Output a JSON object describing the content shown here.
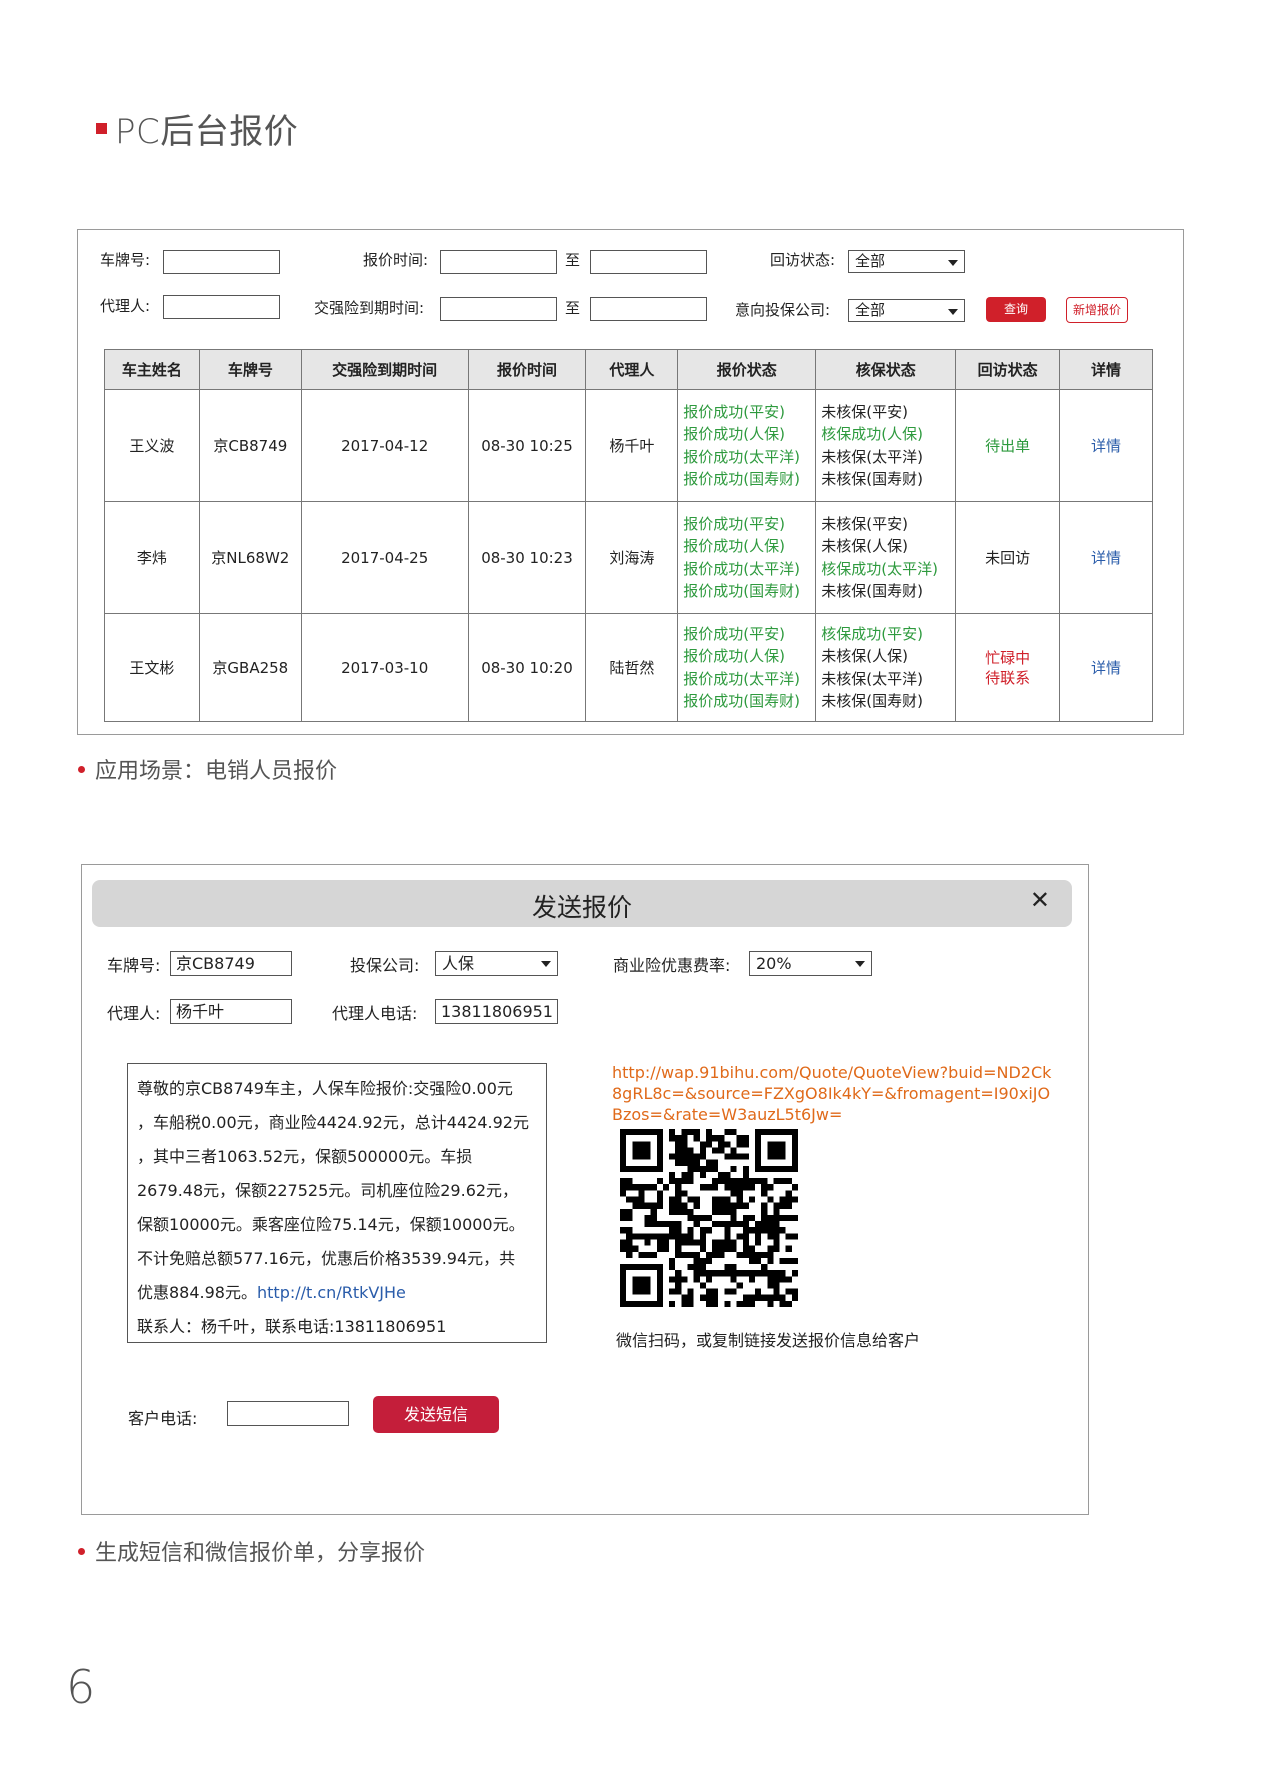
{
  "page_title": "PC后台报价",
  "caption1": "应用场景：电销人员报价",
  "caption2": "生成短信和微信报价单，分享报价",
  "page_number": "6",
  "search": {
    "plate_label": "车牌号:",
    "quote_time_label": "报价时间:",
    "to1": "至",
    "visit_status_label": "回访状态:",
    "visit_status_value": "全部",
    "agent_label": "代理人:",
    "expiry_label": "交强险到期时间:",
    "to2": "至",
    "company_label": "意向投保公司:",
    "company_value": "全部",
    "query_button": "查询",
    "new_quote_button": "新增报价"
  },
  "table": {
    "headers": [
      "车主姓名",
      "车牌号",
      "交强险到期时间",
      "报价时间",
      "代理人",
      "报价状态",
      "核保状态",
      "回访状态",
      "详情"
    ],
    "rows": [
      {
        "owner": "王义波",
        "plate": "京CB8749",
        "expiry": "2017-04-12",
        "quote_time": "08-30 10:25",
        "agent": "杨千叶",
        "quote_status": [
          "报价成功(平安)",
          "报价成功(人保)",
          "报价成功(太平洋)",
          "报价成功(国寿财)"
        ],
        "uw_status": [
          "未核保(平安)",
          "核保成功(人保)",
          "未核保(太平洋)",
          "未核保(国寿财)"
        ],
        "visit_line1": "待出单",
        "visit_line2": "",
        "detail": "详情"
      },
      {
        "owner": "李炜",
        "plate": "京NL68W2",
        "expiry": "2017-04-25",
        "quote_time": "08-30 10:23",
        "agent": "刘海涛",
        "quote_status": [
          "报价成功(平安)",
          "报价成功(人保)",
          "报价成功(太平洋)",
          "报价成功(国寿财)"
        ],
        "uw_status": [
          "未核保(平安)",
          "未核保(人保)",
          "核保成功(太平洋)",
          "未核保(国寿财)"
        ],
        "visit_line1": "未回访",
        "visit_line2": "",
        "detail": "详情"
      },
      {
        "owner": "王文彬",
        "plate": "京GBA258",
        "expiry": "2017-03-10",
        "quote_time": "08-30 10:20",
        "agent": "陆哲然",
        "quote_status": [
          "报价成功(平安)",
          "报价成功(人保)",
          "报价成功(太平洋)",
          "报价成功(国寿财)"
        ],
        "uw_status": [
          "核保成功(平安)",
          "未核保(人保)",
          "未核保(太平洋)",
          "未核保(国寿财)"
        ],
        "visit_line1": "忙碌中",
        "visit_line2": "待联系",
        "detail": "详情"
      }
    ]
  },
  "dialog": {
    "title": "发送报价",
    "close": "✕",
    "plate_label": "车牌号:",
    "plate_value": "京CB8749",
    "company_label": "投保公司:",
    "company_value": "人保",
    "discount_label": "商业险优惠费率:",
    "discount_value": "20%",
    "agent_label": "代理人:",
    "agent_value": "杨千叶",
    "agent_phone_label": "代理人电话:",
    "agent_phone_value": "13811806951",
    "sms_lines": [
      "尊敬的京CB8749车主，人保车险报价:交强险0.00元",
      "，车船税0.00元，商业险4424.92元，总计4424.92元",
      "，其中三者1063.52元，保额500000元。车损",
      "2679.48元，保额227525元。司机座位险29.62元，",
      "保额10000元。乘客座位险75.14元，保额10000元。",
      "不计免赔总额577.16元，优惠后价格3539.94元，共"
    ],
    "sms_line7_text": "优惠884.98元。",
    "sms_short_link": "http://t.cn/RtkVJHe",
    "sms_contact": "联系人：杨千叶，联系电话:13811806951",
    "quote_url": "http://wap.91bihu.com/Quote/QuoteView?buid=ND2Ck8gRL8c=&source=FZXgO8Ik4kY=&fromagent=I90xiJOBzos=&rate=W3auzL5t6Jw=",
    "qr_caption": "微信扫码，或复制链接发送报价信息给客户",
    "customer_phone_label": "客户电话:",
    "send_button": "发送短信"
  },
  "colors": {
    "accent_red": "#d0202a",
    "success_green": "#2e9a3e",
    "link_blue": "#2a5caa",
    "link_orange": "#e06a1a"
  }
}
